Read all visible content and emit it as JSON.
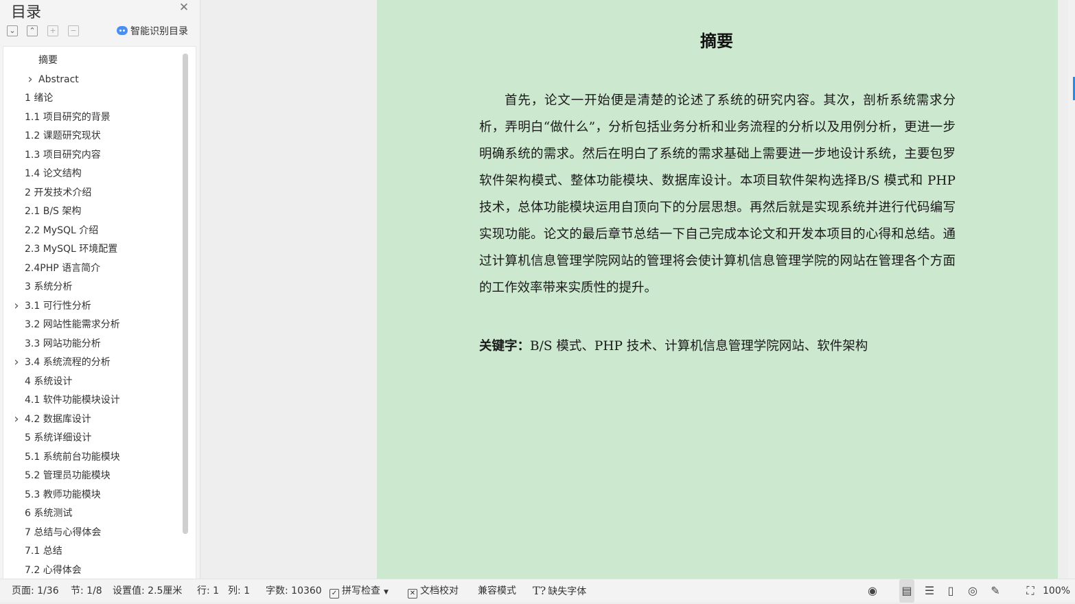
{
  "sidebar": {
    "title": "目录",
    "smart_toc_label": "智能识别目录",
    "toc": [
      {
        "label": "摘要",
        "level": 2,
        "expandable": false
      },
      {
        "label": "Abstract",
        "level": 2,
        "expandable": true
      },
      {
        "label": "1 绪论",
        "level": 1,
        "expandable": false
      },
      {
        "label": "1.1 项目研究的背景",
        "level": 1,
        "expandable": false
      },
      {
        "label": "1.2 课题研究现状",
        "level": 1,
        "expandable": false
      },
      {
        "label": "1.3 项目研究内容",
        "level": 1,
        "expandable": false
      },
      {
        "label": "1.4 论文结构",
        "level": 1,
        "expandable": false
      },
      {
        "label": "2 开发技术介绍",
        "level": 1,
        "expandable": false
      },
      {
        "label": "2.1 B/S 架构",
        "level": 1,
        "expandable": false
      },
      {
        "label": "2.2 MySQL 介绍",
        "level": 1,
        "expandable": false
      },
      {
        "label": "2.3 MySQL 环境配置",
        "level": 1,
        "expandable": false
      },
      {
        "label": "2.4PHP 语言简介",
        "level": 1,
        "expandable": false
      },
      {
        "label": "3 系统分析",
        "level": 1,
        "expandable": false
      },
      {
        "label": "3.1 可行性分析",
        "level": 1,
        "expandable": true
      },
      {
        "label": "3.2 网站性能需求分析",
        "level": 1,
        "expandable": false
      },
      {
        "label": "3.3 网站功能分析",
        "level": 1,
        "expandable": false
      },
      {
        "label": "3.4 系统流程的分析",
        "level": 1,
        "expandable": true
      },
      {
        "label": "4 系统设计",
        "level": 1,
        "expandable": false
      },
      {
        "label": "4.1  软件功能模块设计",
        "level": 1,
        "expandable": false
      },
      {
        "label": "4.2  数据库设计",
        "level": 1,
        "expandable": true
      },
      {
        "label": "5 系统详细设计",
        "level": 1,
        "expandable": false
      },
      {
        "label": "5.1 系统前台功能模块",
        "level": 1,
        "expandable": false
      },
      {
        "label": "5.2 管理员功能模块",
        "level": 1,
        "expandable": false
      },
      {
        "label": "5.3 教师功能模块",
        "level": 1,
        "expandable": false
      },
      {
        "label": "6 系统测试",
        "level": 1,
        "expandable": false
      },
      {
        "label": "7 总结与心得体会",
        "level": 1,
        "expandable": false
      },
      {
        "label": "7.1  总结",
        "level": 1,
        "expandable": false
      },
      {
        "label": "7.2  心得体会",
        "level": 1,
        "expandable": false
      }
    ]
  },
  "document": {
    "heading": "摘要",
    "paragraph": "首先，论文一开始便是清楚的论述了系统的研究内容。其次，剖析系统需求分析，弄明白“做什么”，分析包括业务分析和业务流程的分析以及用例分析，更进一步明确系统的需求。然后在明白了系统的需求基础上需要进一步地设计系统，主要包罗软件架构模式、整体功能模块、数据库设计。本项目软件架构选择B/S 模式和 PHP 技术，总体功能模块运用自顶向下的分层思想。再然后就是实现系统并进行代码编写实现功能。论文的最后章节总结一下自己完成本论文和开发本项目的心得和总结。通过计算机信息管理学院网站的管理将会使计算机信息管理学院的网站在管理各个方面的工作效率带来实质性的提升。",
    "keywords_label": "关键字：",
    "keywords_text": "B/S 模式、PHP 技术、计算机信息管理学院网站、软件架构"
  },
  "statusbar": {
    "page": "页面: 1/36",
    "section": "节: 1/8",
    "setting": "设置值: 2.5厘米",
    "row": "行: 1",
    "col": "列: 1",
    "words": "字数: 10360",
    "spellcheck": "拼写检查",
    "proofread": "文档校对",
    "compat": "兼容模式",
    "missing_font": "缺失字体",
    "zoom": "100%"
  },
  "colors": {
    "page_background": "#cce8cf",
    "accent": "#2a8ae8"
  }
}
